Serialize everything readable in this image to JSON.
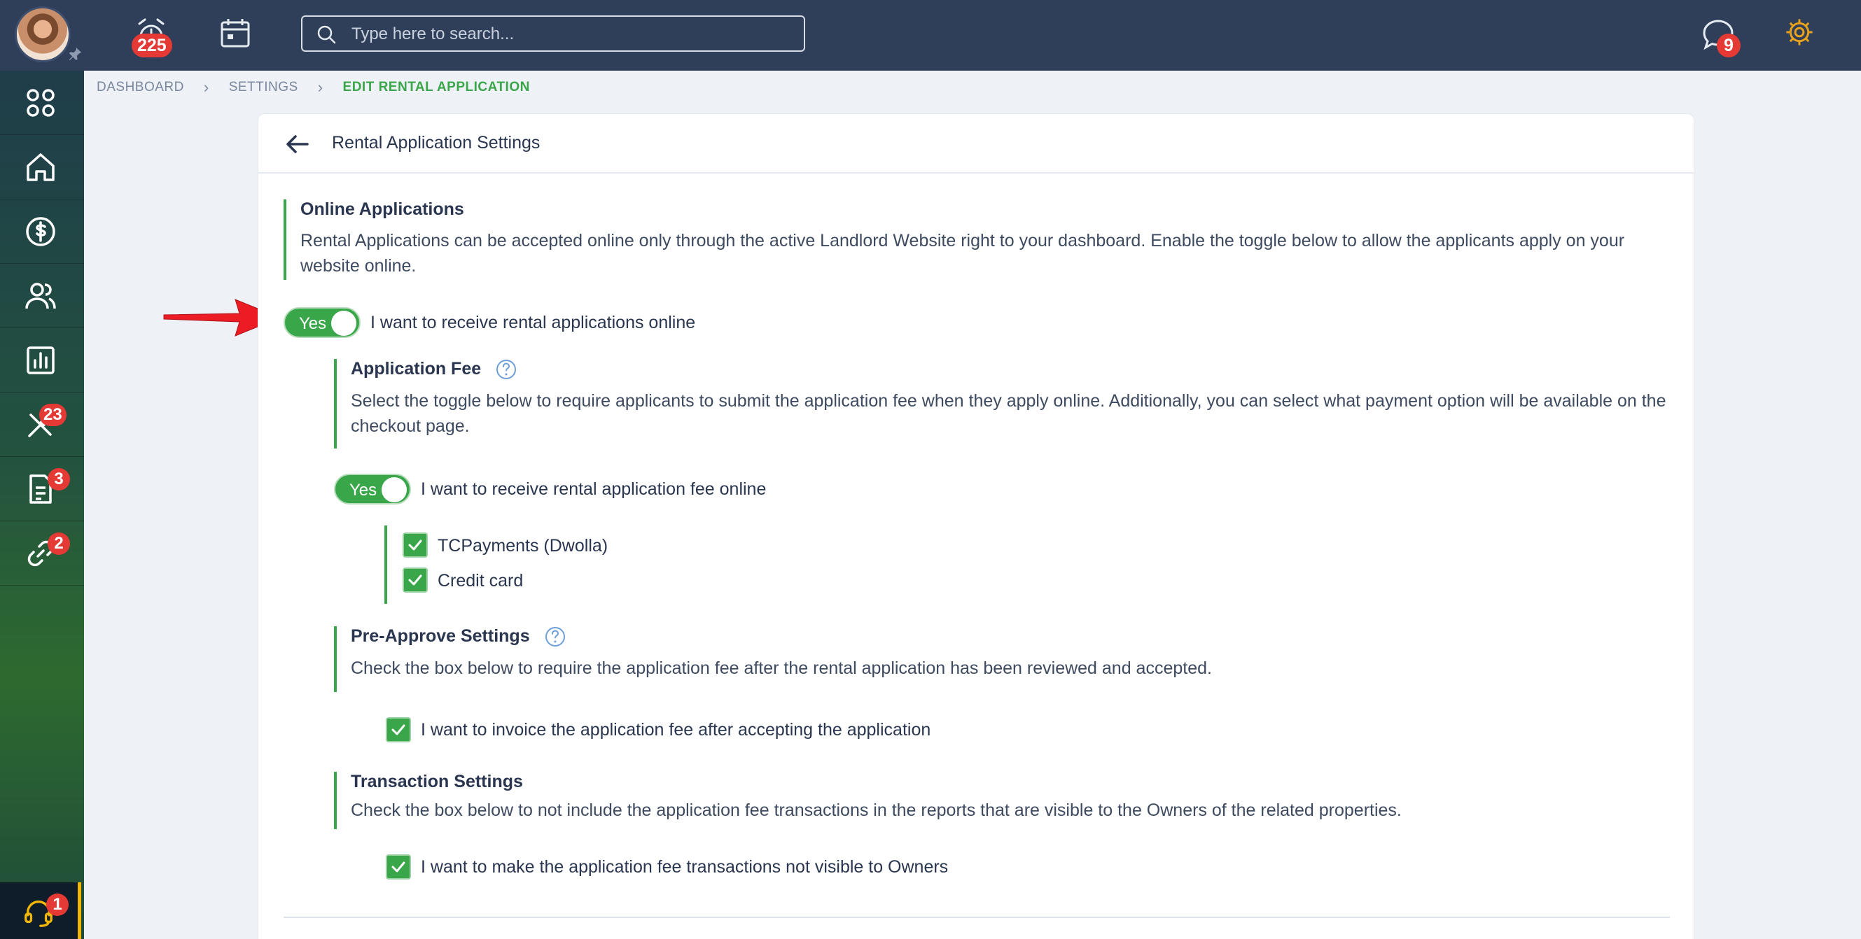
{
  "topbar": {
    "notifications_count": "225",
    "messages_count": "9",
    "search_placeholder": "Type here to search..."
  },
  "sidebar": {
    "maintenance_badge": "23",
    "documents_badge": "3",
    "links_badge": "2",
    "support_badge": "1"
  },
  "breadcrumb": {
    "items": [
      "DASHBOARD",
      "SETTINGS",
      "EDIT RENTAL APPLICATION"
    ]
  },
  "page": {
    "title": "Rental Application Settings"
  },
  "online_applications": {
    "title": "Online Applications",
    "description": "Rental Applications can be accepted online only through the active Landlord Website right to your dashboard. Enable the toggle below to allow the applicants apply on your website online.",
    "toggle_label": "Yes",
    "toggle_text": "I want to receive rental applications online"
  },
  "application_fee": {
    "title": "Application Fee",
    "description": "Select the toggle below to require applicants to submit the application fee when they apply online. Additionally, you can select what payment option will be available on the checkout page.",
    "toggle_label": "Yes",
    "toggle_text": "I want to receive rental application fee online",
    "options": [
      "TCPayments (Dwolla)",
      "Credit card"
    ]
  },
  "pre_approve": {
    "title": "Pre-Approve Settings",
    "description": "Check the box below to require the application fee after the rental application has been reviewed and accepted.",
    "checkbox_text": "I want to invoice the application fee after accepting the application"
  },
  "transaction": {
    "title": "Transaction Settings",
    "description": "Check the box below to not include the application fee transactions in the reports that are visible to the Owners of the related properties.",
    "checkbox_text": "I want to make the application fee transactions not visible to Owners"
  },
  "colors": {
    "accent": "#3aa64a",
    "topbar": "#2f3f5a",
    "badge": "#e53935",
    "gear": "#e9a21a"
  }
}
